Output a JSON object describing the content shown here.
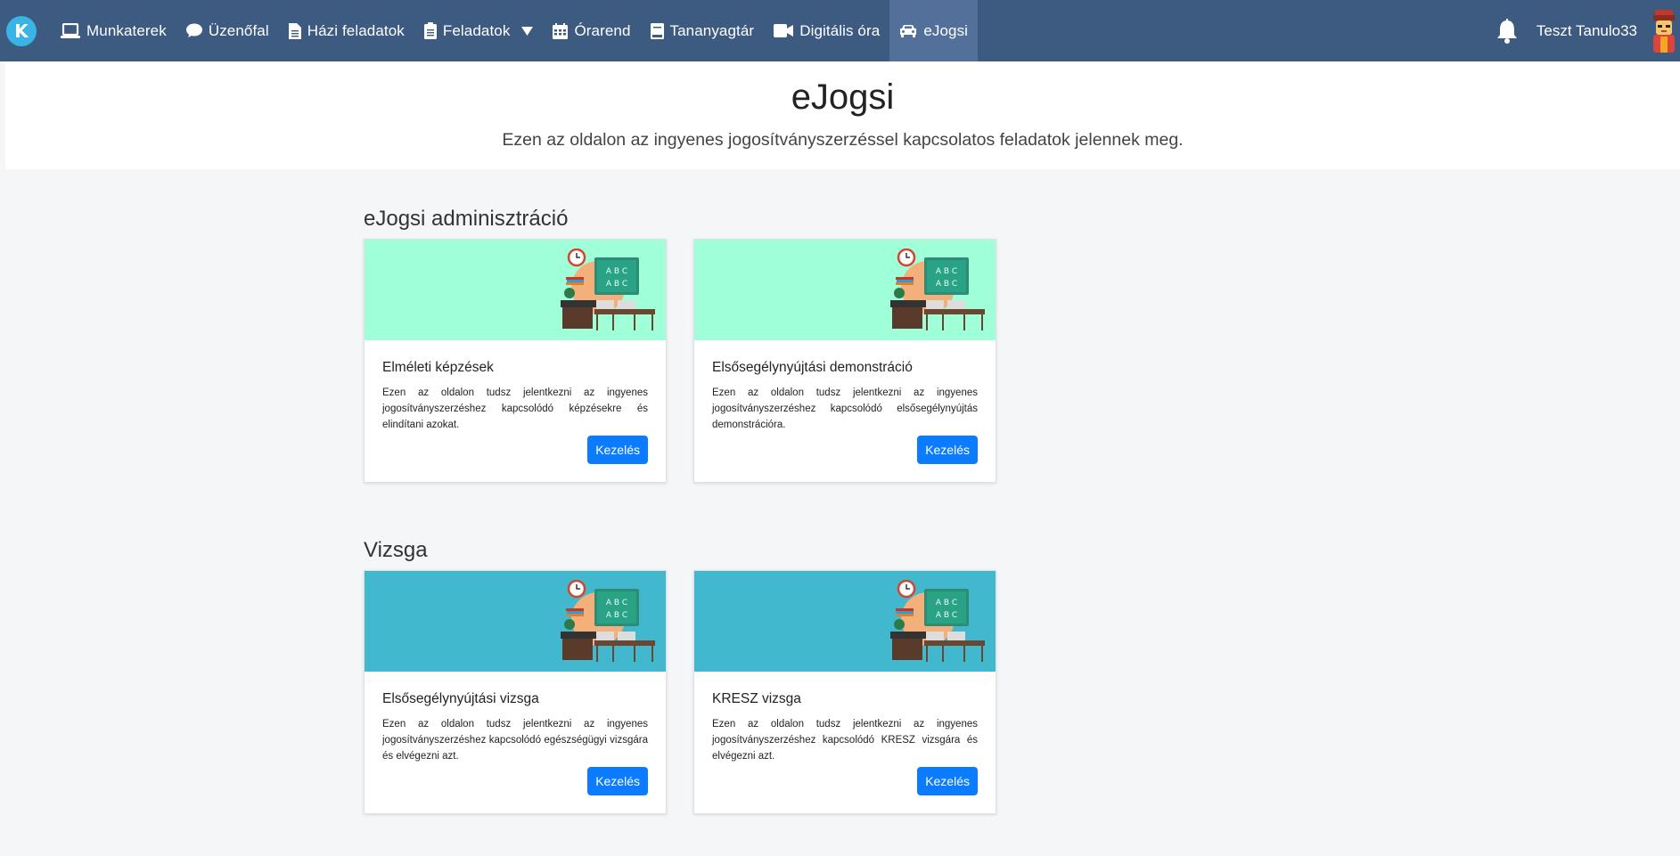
{
  "app": {
    "logo_letter": "K"
  },
  "nav": {
    "items": [
      {
        "label": "Munkaterek",
        "icon": "laptop-icon"
      },
      {
        "label": "Üzenőfal",
        "icon": "chat-bubble-icon"
      },
      {
        "label": "Házi feladatok",
        "icon": "document-icon"
      },
      {
        "label": "Feladatok",
        "icon": "clipboard-icon",
        "dropdown": true
      },
      {
        "label": "Órarend",
        "icon": "calendar-icon"
      },
      {
        "label": "Tananyagtár",
        "icon": "book-icon"
      },
      {
        "label": "Digitális óra",
        "icon": "video-icon"
      },
      {
        "label": "eJogsi",
        "icon": "car-icon",
        "active": true
      }
    ],
    "user_name": "Teszt Tanulo33"
  },
  "header": {
    "title": "eJogsi",
    "subtitle": "Ezen az oldalon az ingyenes jogosítványszerzéssel kapcsolatos feladatok jelennek meg."
  },
  "sections": [
    {
      "title": "eJogsi adminisztráció",
      "banner_color": "#9effd9",
      "cards": [
        {
          "title": "Elméleti képzések",
          "text": "Ezen az oldalon tudsz jelentkezni az ingyenes jogosítványszerzéshez kapcsolódó képzésekre és elindítani azokat.",
          "button": "Kezelés"
        },
        {
          "title": "Elsősegélynyújtási demonstráció",
          "text": "Ezen az oldalon tudsz jelentkezni az ingyenes jogosítványszerzéshez kapcsolódó elsősegélynyújtás demonstrációra.",
          "button": "Kezelés"
        }
      ]
    },
    {
      "title": "Vizsga",
      "banner_color": "#41b8cd",
      "cards": [
        {
          "title": "Elsősegélynyújtási vizsga",
          "text": "Ezen az oldalon tudsz jelentkezni az ingyenes jogosítványszerzéshez kapcsolódó egészségügyi vizsgára és elvégezni azt.",
          "button": "Kezelés"
        },
        {
          "title": "KRESZ vizsga",
          "text": "Ezen az oldalon tudsz jelentkezni az ingyenes jogosítványszerzéshez kapcsolódó KRESZ vizsgára és elvégezni azt.",
          "button": "Kezelés"
        }
      ]
    }
  ],
  "illustration": {
    "board_text": [
      "A B C",
      "A B C"
    ]
  },
  "colors": {
    "navbar": "#3d5a80",
    "active_nav": "#52709a",
    "button": "#0b7cff",
    "brand": "#39b4e4"
  }
}
